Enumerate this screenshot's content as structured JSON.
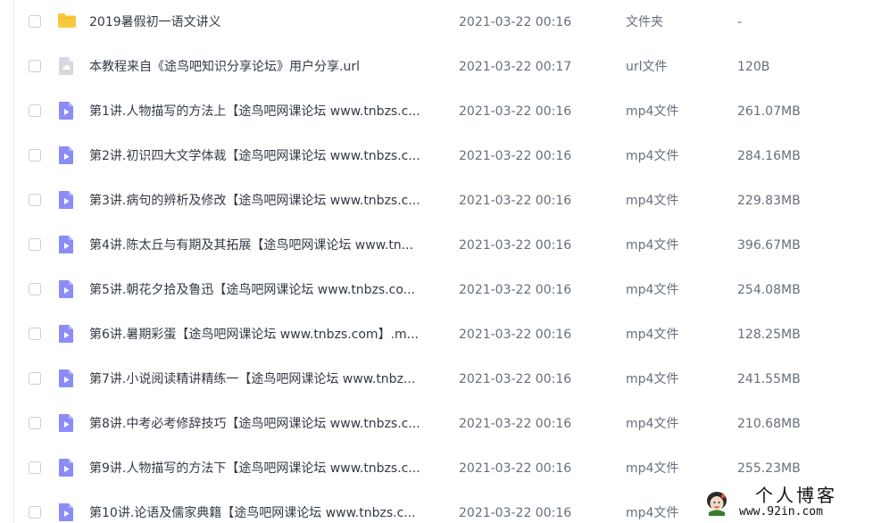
{
  "files": [
    {
      "name": "2019暑假初一语文讲义",
      "modified": "2021-03-22 00:16",
      "type": "文件夹",
      "size": "-",
      "icon": "folder-icon"
    },
    {
      "name": "本教程来自《途鸟吧知识分享论坛》用户分享.url",
      "modified": "2021-03-22 00:17",
      "type": "url文件",
      "size": "120B",
      "icon": "link-file-icon"
    },
    {
      "name": "第1讲.人物描写的方法上【途鸟吧网课论坛 www.tnbzs.c...",
      "modified": "2021-03-22 00:16",
      "type": "mp4文件",
      "size": "261.07MB",
      "icon": "video-file-icon"
    },
    {
      "name": "第2讲.初识四大文学体裁【途鸟吧网课论坛 www.tnbzs.c...",
      "modified": "2021-03-22 00:16",
      "type": "mp4文件",
      "size": "284.16MB",
      "icon": "video-file-icon"
    },
    {
      "name": "第3讲.病句的辨析及修改【途鸟吧网课论坛 www.tnbzs.c...",
      "modified": "2021-03-22 00:16",
      "type": "mp4文件",
      "size": "229.83MB",
      "icon": "video-file-icon"
    },
    {
      "name": "第4讲.陈太丘与有期及其拓展【途鸟吧网课论坛 www.tn...",
      "modified": "2021-03-22 00:16",
      "type": "mp4文件",
      "size": "396.67MB",
      "icon": "video-file-icon"
    },
    {
      "name": "第5讲.朝花夕拾及鲁迅【途鸟吧网课论坛 www.tnbzs.co...",
      "modified": "2021-03-22 00:16",
      "type": "mp4文件",
      "size": "254.08MB",
      "icon": "video-file-icon"
    },
    {
      "name": "第6讲.暑期彩蛋【途鸟吧网课论坛 www.tnbzs.com】.m...",
      "modified": "2021-03-22 00:16",
      "type": "mp4文件",
      "size": "128.25MB",
      "icon": "video-file-icon"
    },
    {
      "name": "第7讲.小说阅读精讲精练一【途鸟吧网课论坛 www.tnbz...",
      "modified": "2021-03-22 00:16",
      "type": "mp4文件",
      "size": "241.55MB",
      "icon": "video-file-icon"
    },
    {
      "name": "第8讲.中考必考修辞技巧【途鸟吧网课论坛 www.tnbzs.c...",
      "modified": "2021-03-22 00:16",
      "type": "mp4文件",
      "size": "210.68MB",
      "icon": "video-file-icon"
    },
    {
      "name": "第9讲.人物描写的方法下【途鸟吧网课论坛 www.tnbzs.c...",
      "modified": "2021-03-22 00:16",
      "type": "mp4文件",
      "size": "255.23MB",
      "icon": "video-file-icon"
    },
    {
      "name": "第10讲.论语及儒家典籍【途鸟吧网课论坛 www.tnbzs.c...",
      "modified": "2021-03-22 00:16",
      "type": "mp4文件",
      "size": "",
      "icon": "video-file-icon"
    }
  ],
  "watermark": {
    "title": "个人博客",
    "url": "www.92in.com"
  },
  "colors": {
    "folder": "#f8c93b",
    "video": "#8c8cf7",
    "link_file": "#d5d8de",
    "text_primary": "#333a44",
    "text_secondary": "#666f7a"
  }
}
